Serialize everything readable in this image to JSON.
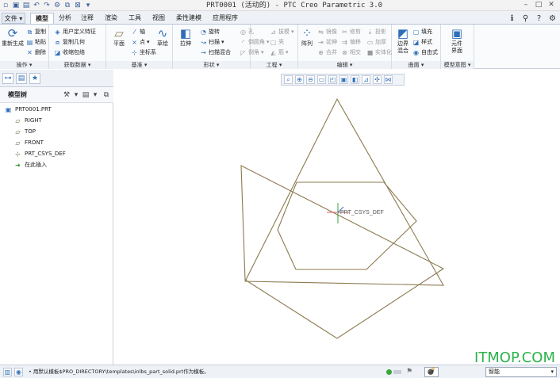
{
  "window": {
    "title": "PRT0001 (活动的) - PTC Creo Parametric 3.0"
  },
  "quick_access": [
    "new-icon",
    "open-icon",
    "save-icon",
    "undo-icon",
    "redo-icon",
    "regenerate-icon",
    "window-icon",
    "close-window-icon",
    "customize-icon"
  ],
  "tabs": [
    "文件",
    "模型",
    "分析",
    "注释",
    "渲染",
    "工具",
    "视图",
    "柔性建模",
    "应用程序"
  ],
  "active_tab": "模型",
  "ribbon": {
    "operations": {
      "label": "操作",
      "regenerate": "重新生成",
      "copy": "复制",
      "paste": "粘贴",
      "delete": "删除"
    },
    "get_data": {
      "label": "获取数据",
      "udf": "用户定义特征",
      "copy_geom": "复制几何",
      "shrinkwrap": "收缩包络"
    },
    "datum": {
      "label": "基准",
      "plane": "平面",
      "axis": "轴",
      "point": "点",
      "csys": "坐标系",
      "sketch": "草绘"
    },
    "shapes": {
      "label": "形状",
      "extrude": "拉伸",
      "revolve": "旋转",
      "sweep": "扫描",
      "swept_blend": "扫描混合"
    },
    "engineering": {
      "label": "工程",
      "hole": "孔",
      "round": "倒圆角",
      "chamfer": "倒角",
      "draft": "拔模",
      "shell": "壳",
      "rib": "筋"
    },
    "editing": {
      "label": "编辑",
      "pattern": "阵列",
      "mirror": "镜像",
      "extend": "延伸",
      "trim": "修剪",
      "offset": "偏移",
      "merge": "合并",
      "intersect": "相交",
      "project": "投影",
      "thicken": "加厚",
      "solidify": "实体化"
    },
    "surfaces": {
      "label": "曲面",
      "boundary_blend": "边界混合",
      "fill": "填充",
      "style": "样式",
      "freestyle": "自由式"
    },
    "model_intent": {
      "label": "模型意图",
      "component_interface": "元件界面"
    }
  },
  "model_tree": {
    "header": "模型树",
    "items": [
      {
        "icon": "part-icon",
        "label": "PRT0001.PRT"
      },
      {
        "icon": "datum-plane-icon",
        "label": "RIGHT"
      },
      {
        "icon": "datum-plane-icon",
        "label": "TOP"
      },
      {
        "icon": "datum-plane-icon",
        "label": "FRONT"
      },
      {
        "icon": "csys-icon",
        "label": "PRT_CSYS_DEF"
      },
      {
        "icon": "insert-here-icon",
        "label": "在此插入"
      }
    ]
  },
  "view_toolbar": [
    "refit-icon",
    "zoom-in-icon",
    "zoom-out-icon",
    "repaint-icon",
    "view-manager-icon",
    "saved-views-icon",
    "display-style-icon",
    "datum-display-icon",
    "spin-center-icon",
    "annotation-icon"
  ],
  "graphics": {
    "csys_label": "PRT_CSYS_DEF",
    "datum_color": "#8b7a4f"
  },
  "status": {
    "message": "• 用默认模板$PRO_DIRECTORY\\templates\\inlbs_part_solid.prt作为模板。",
    "find_label": "💣",
    "filter_value": "智能"
  },
  "watermark": "ITMOP.COM"
}
